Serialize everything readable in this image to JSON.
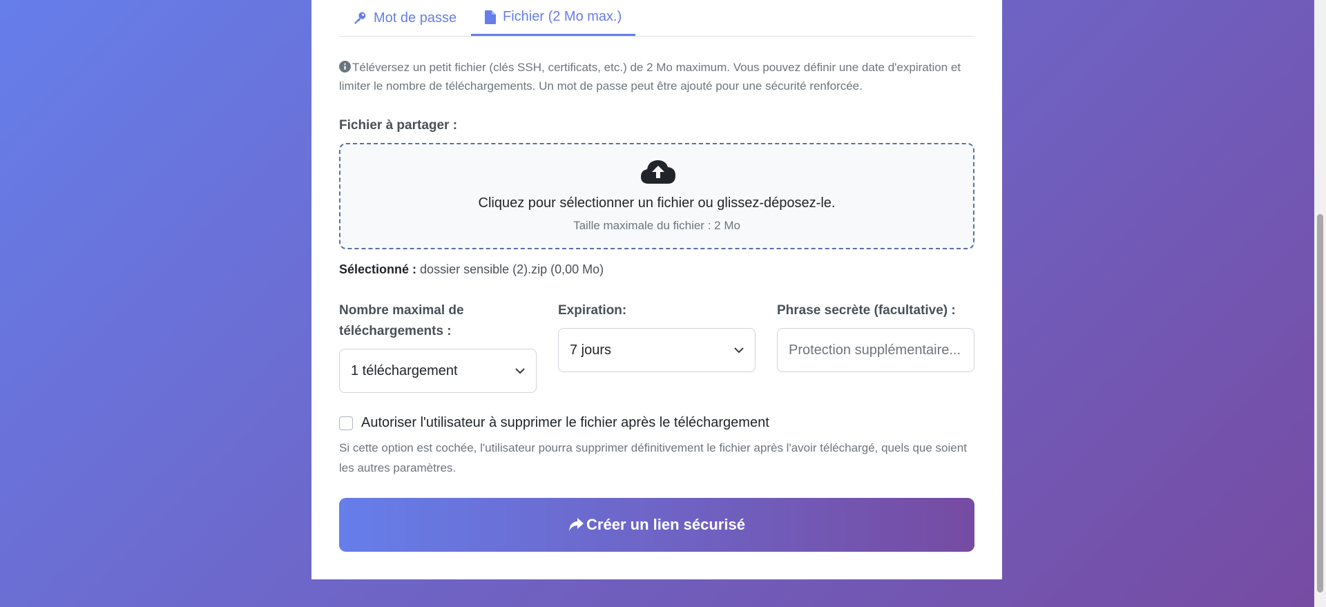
{
  "tabs": {
    "password_label": "Mot de passe",
    "file_label": "Fichier (2 Mo max.)"
  },
  "info_text": "Téléversez un petit fichier (clés SSH, certificats, etc.) de 2 Mo maximum. Vous pouvez définir une date d'expiration et limiter le nombre de téléchargements. Un mot de passe peut être ajouté pour une sécurité renforcée.",
  "file_section": {
    "label": "Fichier à partager :",
    "dropzone_text": "Cliquez pour sélectionner un fichier ou glissez-déposez-le.",
    "dropzone_subtext": "Taille maximale du fichier : 2 Mo",
    "selected_label": "Sélectionné :",
    "selected_value": "dossier sensible (2).zip (0,00 Mo)"
  },
  "fields": {
    "max_downloads": {
      "label": "Nombre maximal de téléchargements :",
      "value": "1 téléchargement"
    },
    "expiration": {
      "label": "Expiration:",
      "value": "7 jours"
    },
    "passphrase": {
      "label": "Phrase secrète (facultative) :",
      "placeholder": "Protection supplémentaire..."
    }
  },
  "allow_delete": {
    "label": "Autoriser l'utilisateur à supprimer le fichier après le téléchargement",
    "help": "Si cette option est cochée, l'utilisateur pourra supprimer définitivement le fichier après l'avoir téléchargé, quels que soient les autres paramètres."
  },
  "submit_label": "Créer un lien sécurisé",
  "colors": {
    "accent": "#667eea",
    "accent_end": "#764ba2"
  },
  "icons": {
    "password_tab": "key-icon",
    "file_tab": "file-icon",
    "info": "info-circle-icon",
    "upload": "cloud-upload-icon",
    "select": "chevron-down-icon",
    "submit": "share-arrow-icon"
  }
}
